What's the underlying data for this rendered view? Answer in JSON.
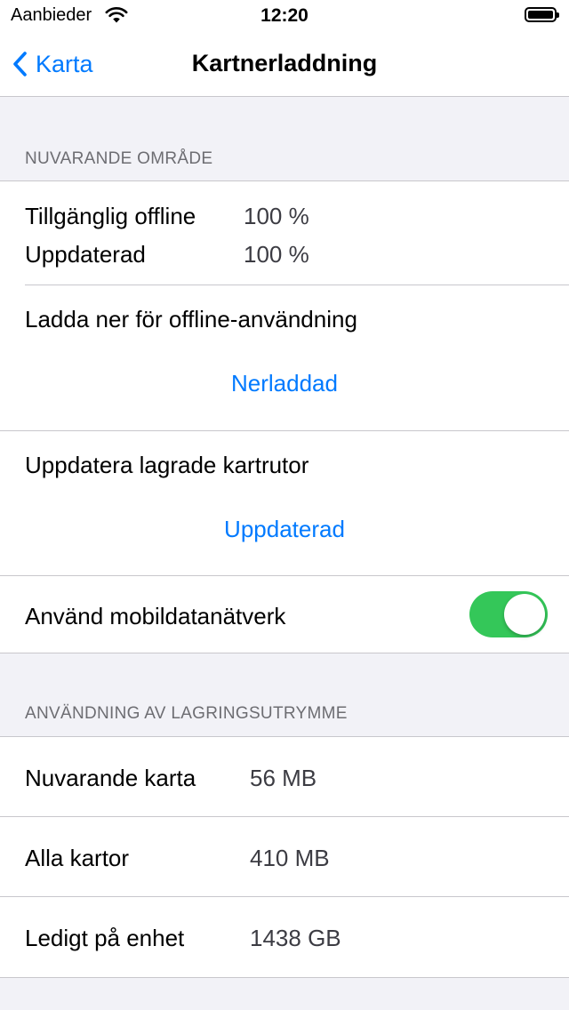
{
  "status_bar": {
    "carrier": "Aanbieder",
    "time": "12:20"
  },
  "nav": {
    "back_label": "Karta",
    "title": "Kartnerladdning"
  },
  "current_area": {
    "header": "NUVARANDE OMRÅDE",
    "offline_label": "Tillgänglig offline",
    "offline_value": "100 %",
    "updated_label": "Uppdaterad",
    "updated_value": "100 %",
    "download_label": "Ladda ner för offline-användning",
    "download_status": "Nerladdad",
    "update_label": "Uppdatera lagrade kartrutor",
    "update_status": "Uppdaterad",
    "mobile_data_label": "Använd mobildatanätverk",
    "mobile_data_on": true
  },
  "storage": {
    "header": "ANVÄNDNING AV LAGRINGSUTRYMME",
    "rows": [
      {
        "label": "Nuvarande karta",
        "value": "56 MB"
      },
      {
        "label": "Alla kartor",
        "value": "410 MB"
      },
      {
        "label": "Ledigt på enhet",
        "value": "1438 GB"
      }
    ]
  },
  "colors": {
    "accent": "#007aff",
    "toggle_on": "#34c759"
  }
}
